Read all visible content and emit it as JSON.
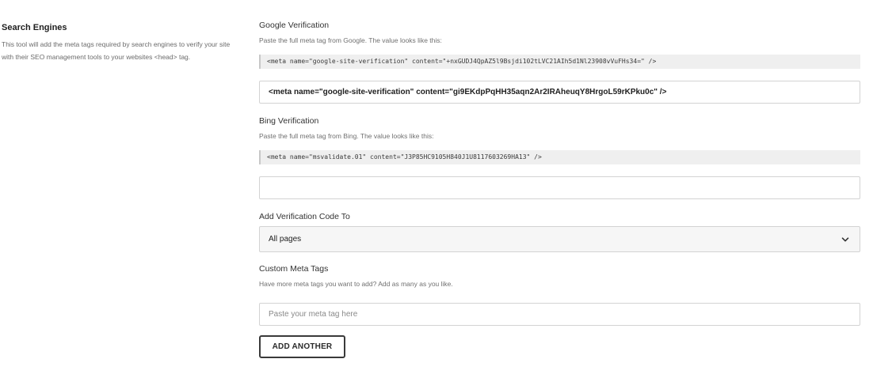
{
  "section": {
    "title": "Search Engines",
    "description": "This tool will add the meta tags required by search engines to verify your site with their SEO management tools to your websites <head> tag."
  },
  "google": {
    "label": "Google Verification",
    "help": "Paste the full meta tag from Google. The value looks like this:",
    "example": "<meta name=\"google-site-verification\" content=\"+nxGUDJ4QpAZ5l9Bsjdi102tLVC21AIh5d1Nl23908vVuFHs34=\" />",
    "value": "<meta name=\"google-site-verification\" content=\"gi9EKdpPqHH35aqn2Ar2IRAheuqY8HrgoL59rKPku0c\" />"
  },
  "bing": {
    "label": "Bing Verification",
    "help": "Paste the full meta tag from Bing. The value looks like this:",
    "example": "<meta name=\"msvalidate.01\" content=\"J3P85HC9105H840J1U8117603269HA13\" />",
    "value": ""
  },
  "verification_target": {
    "label": "Add Verification Code To",
    "selected": "All pages",
    "icon": "chevron-down-icon"
  },
  "custom_meta": {
    "label": "Custom Meta Tags",
    "help": "Have more meta tags you want to add? Add as many as you like.",
    "placeholder": "Paste your meta tag here",
    "add_button_label": "ADD ANOTHER"
  }
}
